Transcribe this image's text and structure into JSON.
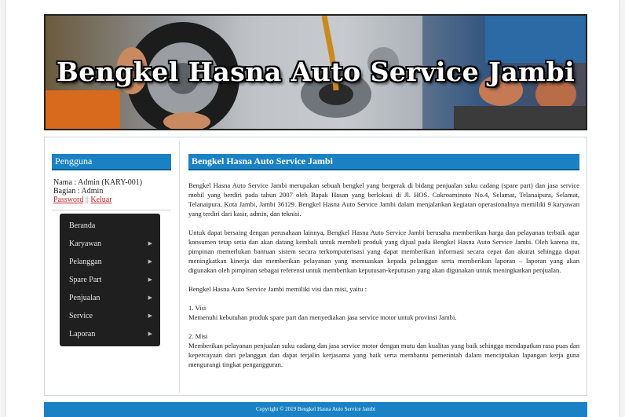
{
  "banner": {
    "title": "Bengkel Hasna Auto Service Jambi"
  },
  "sidebar": {
    "title": "Pengguna",
    "user_name": "Nama : Admin (KARY-001)",
    "user_role": "Bagian : Admin",
    "password_link": "Password",
    "separator": "||",
    "logout_link": "Keluar",
    "menu": [
      {
        "label": "Beranda"
      },
      {
        "label": "Karyawan"
      },
      {
        "label": "Pelanggan"
      },
      {
        "label": "Spare Part"
      },
      {
        "label": "Penjualan"
      },
      {
        "label": "Service"
      },
      {
        "label": "Laporan"
      }
    ]
  },
  "main": {
    "title": "Bengkel Hasna Auto Service Jambi",
    "para1": "Bengkel Hasna Auto Service Jambi merupakan sebuah bengkel yang bergerak di bidang penjualan suku cadang (spare part) dan jasa service mobil yang berdiri pada tahun 2007 oleh Bapak Hasan yang berlokasi di Jl. HOS. Cokroaminoto No.4, Selamat, Telanaipura, Selamat, Telanaipura, Kota Jambi, Jambi 36129. Bengkel Hasna Auto Service Jambi dalam menjalankan kegiatan operasionalnya memiliki 9 karyawan yang terdiri dari kasir, admin, dan teknisi.",
    "para2": "Untuk dapat bersaing dengan perusahaan lainnya, Bengkel Hasna Auto Service Jambi berusaha memberikan harga dan pelayanan terbaik agar konsumen tetap setia dan akan datang kembali untuk membeli produk yang dijual pada Bengkel Hasna Auto Service Jambi. Oleh karena itu, pimpinan memerlukan bantuan sistem secara terkomputerisasi yang dapat memberikan informasi secara cepat dan akurat sehingga dapat meningkatkan kinerja dan memberikan pelayanan yang memuaskan kepada pelanggan serta memberikan laporan – laporan yang akan digunakan oleh pimpinan sebagai referensi untuk memberikan keputusan-keputusan yang akan digunakan untuk meningkatkan penjualan.",
    "para3": "Bengkel Hasna Auto Service Jambi memiliki visi dan misi, yaitu :",
    "visi_label": "1. Visi",
    "visi_text": "Memenuhi kebutuhan produk spare part dan menyediakan jasa service motor untuk provinsi Jambi.",
    "misi_label": "2. Misi",
    "misi_text": "Memberikan pelayanan penjualan suku cadang dan jasa service motor dengan mutu dan kualitas yang baik sehingga mendapatkan rasa puas dan kepercayaan dari pelanggan dan dapat terjalin kerjasama yang baik serta membantu pemerintah dalam menciptakan lapangan kerja guna mengurangi tingkat pengangguran."
  },
  "footer": {
    "text": "Copyright © 2019 Bengkel Hasna Auto Service Jambi"
  }
}
